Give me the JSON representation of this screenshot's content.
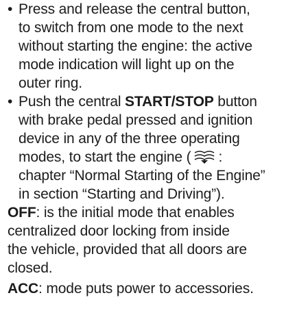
{
  "bullets": [
    {
      "dot": "•",
      "lines": [
        "Press and release the central button,",
        "to switch from one mode to the next",
        "without starting the engine: the active",
        "mode indication will light up on the",
        "outer ring."
      ]
    },
    {
      "dot": "•",
      "l1_pre": "Push the central ",
      "l1_bold": "START/STOP",
      "l1_post": " button",
      "lines_mid": [
        "with brake pedal pressed and ignition",
        "device in any of the three operating"
      ],
      "l4_pre": "modes, to start the engine (",
      "l4_icon": "book-reference-icon",
      "l4_post": ":",
      "lines_end": [
        "chapter “Normal Starting of the Engine”",
        "in section “Starting and Driving”)."
      ]
    }
  ],
  "off": {
    "term": "OFF",
    "l1": ": is the initial mode that enables",
    "lines": [
      "centralized door locking from inside",
      "the vehicle, provided that all doors are",
      "closed."
    ]
  },
  "acc": {
    "term": "ACC",
    "l1": ": mode puts power to accessories."
  },
  "colors": {
    "text": "#1c1c1c"
  }
}
